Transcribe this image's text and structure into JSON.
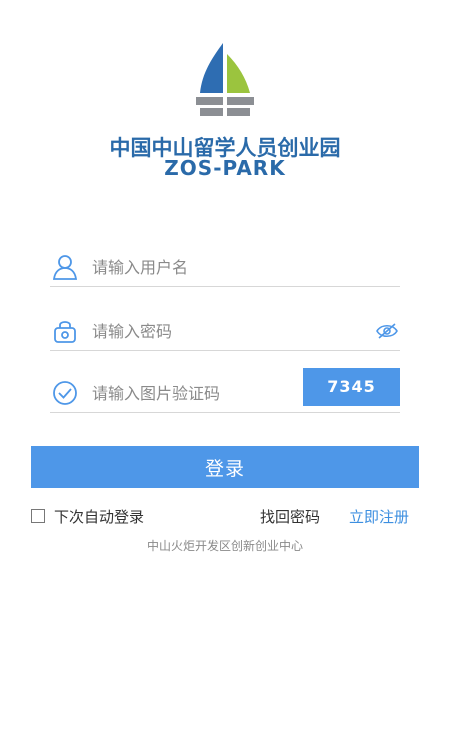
{
  "brand": {
    "name_cn": "中国中山留学人员创业园",
    "name_en": "ZOS-PARK"
  },
  "form": {
    "username_placeholder": "请输入用户名",
    "password_placeholder": "请输入密码",
    "captcha_placeholder": "请输入图片验证码",
    "captcha_code": "7345",
    "login_label": "登录"
  },
  "options": {
    "auto_login_label": "下次自动登录",
    "forgot_password": "找回密码",
    "register": "立即注册"
  },
  "footer": {
    "text": "中山火炬开发区创新创业中心"
  },
  "colors": {
    "primary": "#4e97e8",
    "brand": "#2a6aa9",
    "leaf_green": "#9bc43e",
    "leaf_blue": "#2e6db2",
    "base_gray": "#8c8f94"
  },
  "icons": {
    "username": "user-icon",
    "password": "lock-icon",
    "captcha": "check-circle-icon",
    "toggle_password": "eye-icon",
    "logo": "sailboat-logo-icon"
  }
}
